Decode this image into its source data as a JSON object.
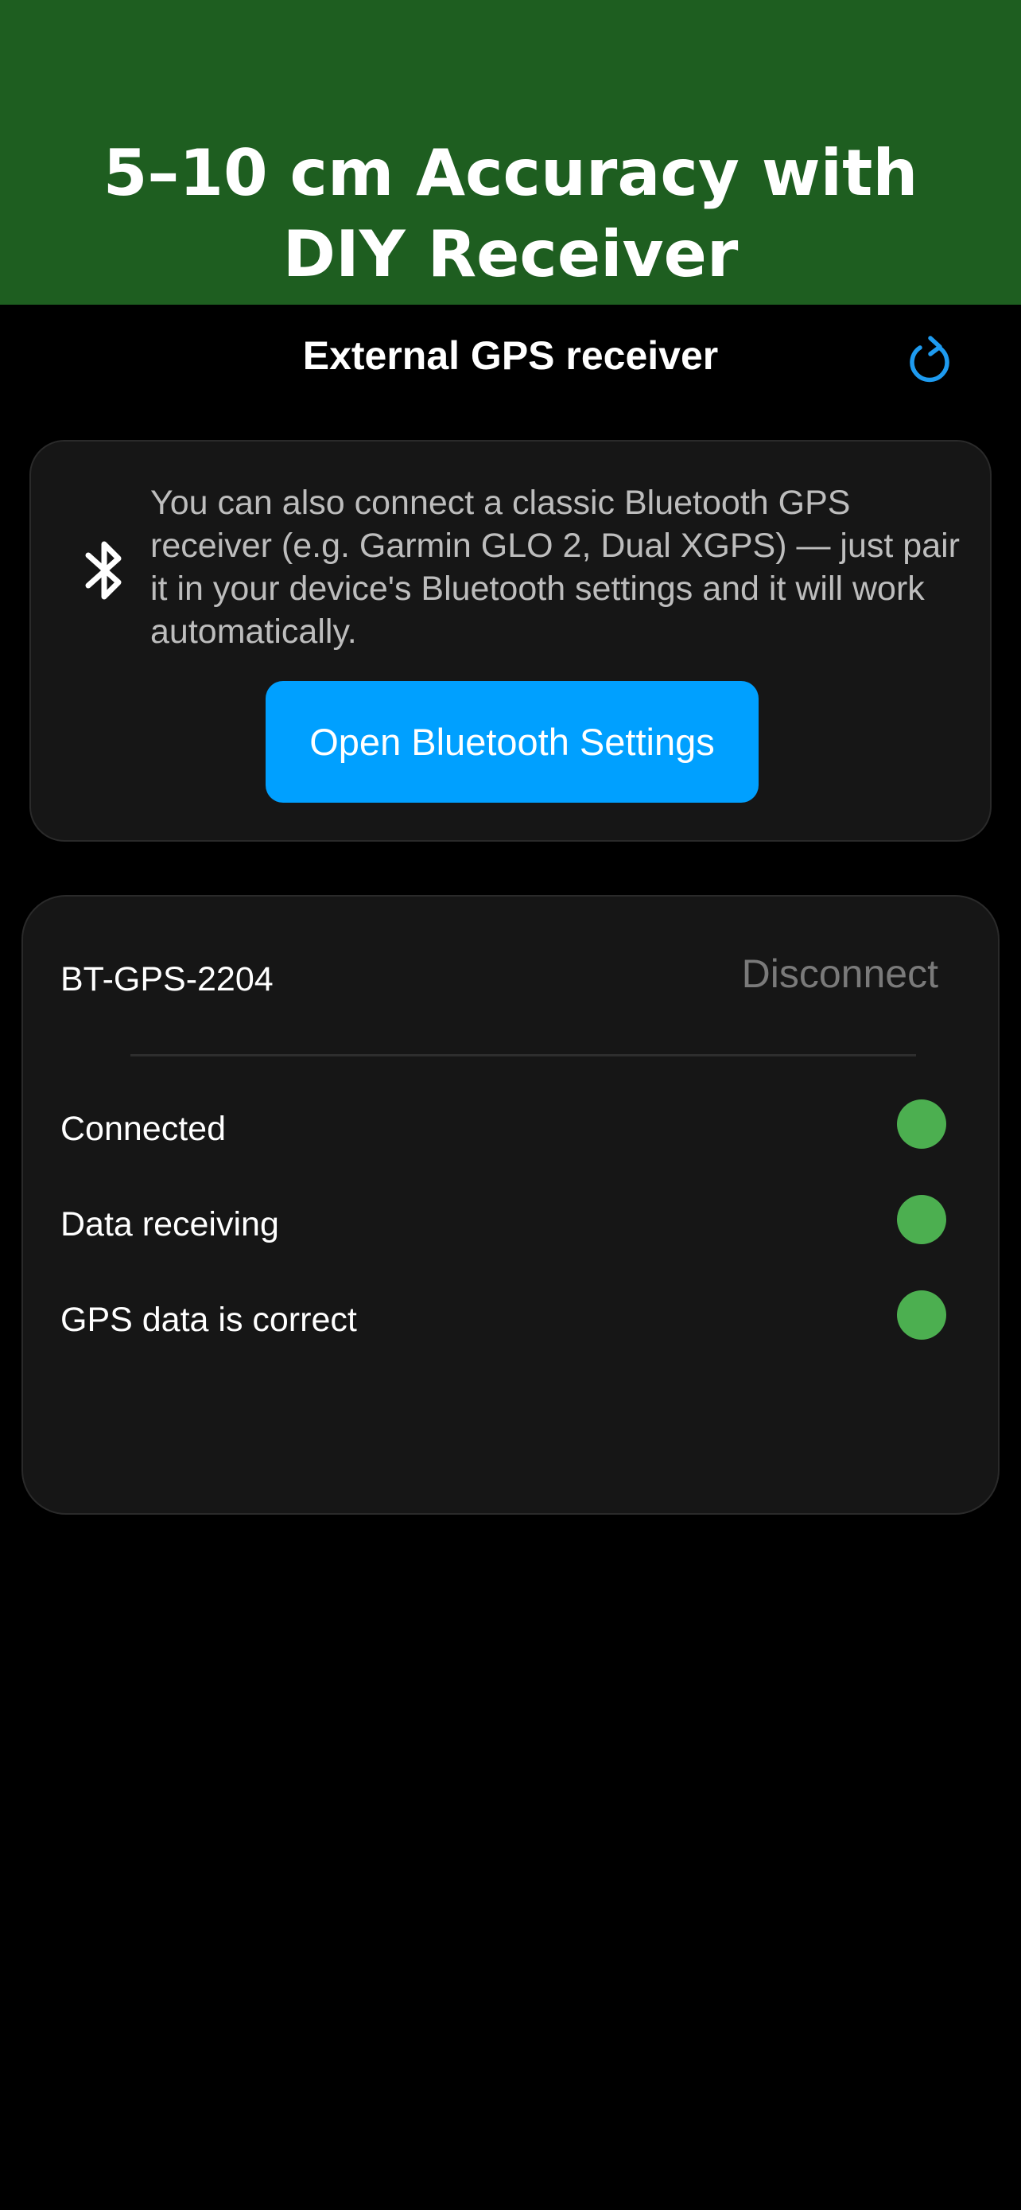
{
  "banner": {
    "title": "5–10 cm Accuracy with DIY Receiver",
    "background": "#1e5e20"
  },
  "header": {
    "title": "External GPS receiver",
    "refresh_icon": "refresh-icon",
    "accent": "#1e9bf0"
  },
  "info": {
    "icon": "bluetooth-icon",
    "text": "You can also connect a classic Bluetooth GPS receiver (e.g. Garmin GLO 2, Dual XGPS) — just pair it in your device's Bluetooth settings and it will work automatically.",
    "button_label": "Open Bluetooth Settings",
    "button_color": "#00a0ff"
  },
  "device": {
    "name": "BT-GPS-2204",
    "disconnect_label": "Disconnect",
    "statuses": [
      {
        "label": "Connected",
        "ok": true
      },
      {
        "label": "Data receiving",
        "ok": true
      },
      {
        "label": "GPS data is correct",
        "ok": true
      }
    ],
    "status_ok_color": "#4caf50"
  }
}
